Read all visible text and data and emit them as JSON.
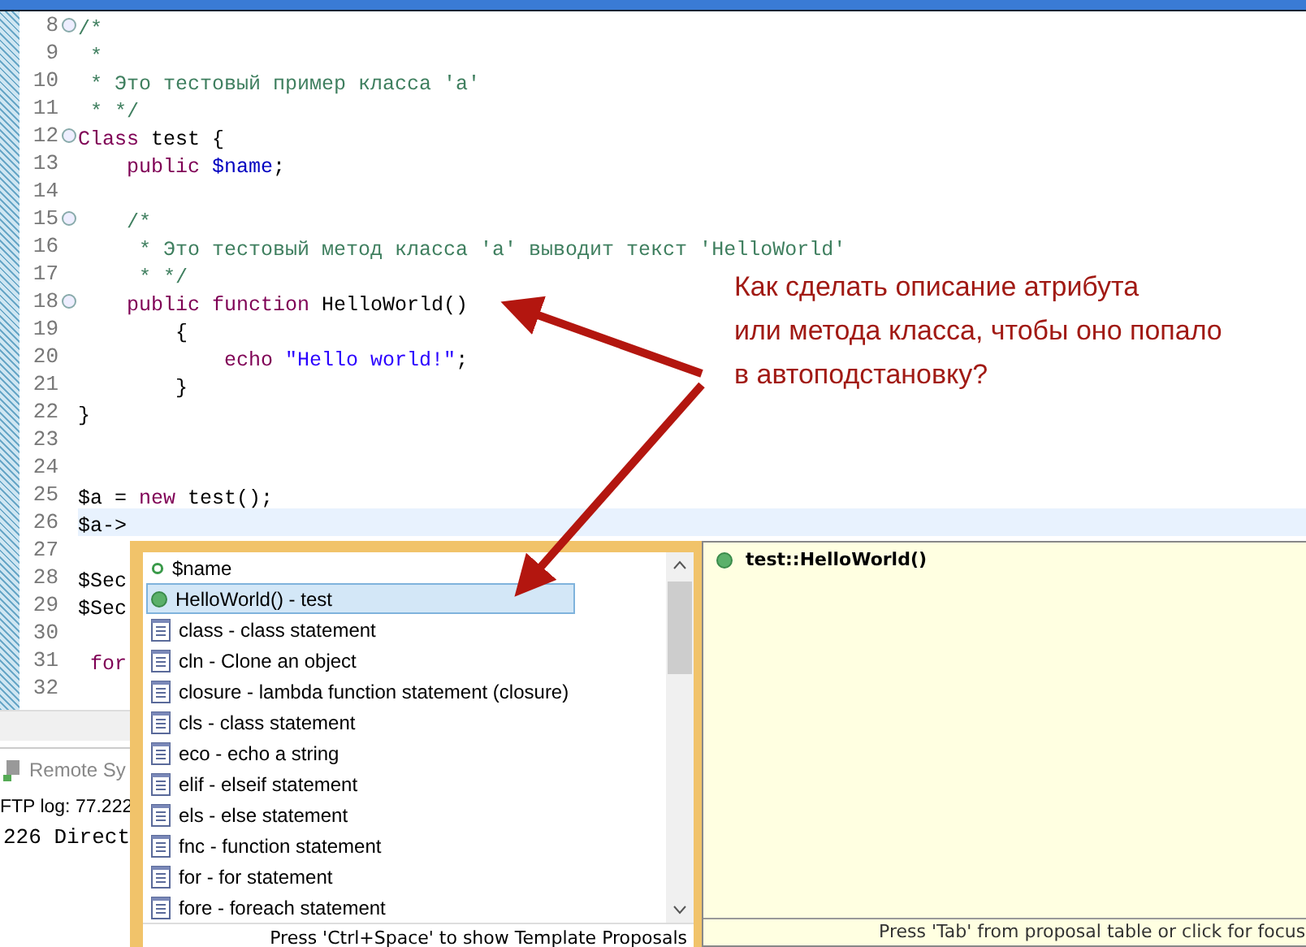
{
  "editor": {
    "lines": [
      {
        "number": "8",
        "foldable": true,
        "current": false,
        "tokens": [
          {
            "kind": "comment",
            "text": "/*"
          }
        ]
      },
      {
        "number": "9",
        "foldable": false,
        "current": false,
        "tokens": [
          {
            "kind": "comment",
            "text": " *"
          }
        ]
      },
      {
        "number": "10",
        "foldable": false,
        "current": false,
        "tokens": [
          {
            "kind": "comment",
            "text": " * Это тестовый пример класса 'a'"
          }
        ]
      },
      {
        "number": "11",
        "foldable": false,
        "current": false,
        "tokens": [
          {
            "kind": "comment",
            "text": " * */"
          }
        ]
      },
      {
        "number": "12",
        "foldable": true,
        "current": false,
        "tokens": [
          {
            "kind": "keyword",
            "text": "Class"
          },
          {
            "kind": "plain",
            "text": " test {"
          }
        ]
      },
      {
        "number": "13",
        "foldable": false,
        "current": false,
        "tokens": [
          {
            "kind": "keyword",
            "text": "    public"
          },
          {
            "kind": "variable",
            "text": " $name"
          },
          {
            "kind": "plain",
            "text": ";"
          }
        ]
      },
      {
        "number": "14",
        "foldable": false,
        "current": false
      },
      {
        "number": "15",
        "foldable": true,
        "current": false,
        "tokens": [
          {
            "kind": "comment",
            "text": "    /*"
          }
        ]
      },
      {
        "number": "16",
        "foldable": false,
        "current": false,
        "tokens": [
          {
            "kind": "comment",
            "text": "     * Это тестовый метод класса 'a' выводит текст 'HelloWorld'"
          }
        ]
      },
      {
        "number": "17",
        "foldable": false,
        "current": false,
        "tokens": [
          {
            "kind": "comment",
            "text": "     * */"
          }
        ]
      },
      {
        "number": "18",
        "foldable": true,
        "current": false,
        "tokens": [
          {
            "kind": "keyword",
            "text": "    public function"
          },
          {
            "kind": "plain",
            "text": " HelloWorld()"
          }
        ]
      },
      {
        "number": "19",
        "foldable": false,
        "current": false,
        "tokens": [
          {
            "kind": "plain",
            "text": "        {"
          }
        ]
      },
      {
        "number": "20",
        "foldable": false,
        "current": false,
        "tokens": [
          {
            "kind": "keyword",
            "text": "            echo"
          },
          {
            "kind": "string",
            "text": " \"Hello world!\""
          },
          {
            "kind": "plain",
            "text": ";"
          }
        ]
      },
      {
        "number": "21",
        "foldable": false,
        "current": false,
        "tokens": [
          {
            "kind": "plain",
            "text": "        }"
          }
        ]
      },
      {
        "number": "22",
        "foldable": false,
        "current": false,
        "tokens": [
          {
            "kind": "plain",
            "text": "}"
          }
        ]
      },
      {
        "number": "23",
        "foldable": false,
        "current": false
      },
      {
        "number": "24",
        "foldable": false,
        "current": false
      },
      {
        "number": "25",
        "foldable": false,
        "current": false,
        "tokens": [
          {
            "kind": "plain",
            "text": "$a = "
          },
          {
            "kind": "keyword",
            "text": "new"
          },
          {
            "kind": "plain",
            "text": " test();"
          }
        ]
      },
      {
        "number": "26",
        "foldable": false,
        "current": true,
        "tokens": [
          {
            "kind": "plain",
            "text": "$a->"
          }
        ]
      },
      {
        "number": "27",
        "foldable": false,
        "current": false
      },
      {
        "number": "28",
        "foldable": false,
        "current": false,
        "tokens": [
          {
            "kind": "plain",
            "text": "$Sec"
          }
        ]
      },
      {
        "number": "29",
        "foldable": false,
        "current": false,
        "tokens": [
          {
            "kind": "plain",
            "text": "$Sec"
          }
        ]
      },
      {
        "number": "30",
        "foldable": false,
        "current": false
      },
      {
        "number": "31",
        "foldable": false,
        "current": false,
        "tokens": [
          {
            "kind": "keyword",
            "text": " for"
          }
        ]
      },
      {
        "number": "32",
        "foldable": false,
        "current": false
      }
    ]
  },
  "bottom_panel": {
    "tab": "Remote Sy",
    "log_label": "FTP log: 77.222",
    "log_line": "226 Direct"
  },
  "annotation": {
    "lines": [
      "Как сделать описание атрибута",
      "или метода класса, чтобы оно попало",
      "в автоподстановку?"
    ]
  },
  "completion": {
    "proposals": [
      {
        "kind": "field",
        "label": "$name",
        "selected": false
      },
      {
        "kind": "method",
        "label": "HelloWorld() - test",
        "selected": true
      },
      {
        "kind": "template",
        "label": "class - class statement",
        "selected": false
      },
      {
        "kind": "template",
        "label": "cln - Clone an object",
        "selected": false
      },
      {
        "kind": "template",
        "label": "closure - lambda function statement (closure)",
        "selected": false
      },
      {
        "kind": "template",
        "label": "cls - class statement",
        "selected": false
      },
      {
        "kind": "template",
        "label": "eco - echo a string",
        "selected": false
      },
      {
        "kind": "template",
        "label": "elif - elseif statement",
        "selected": false
      },
      {
        "kind": "template",
        "label": "els - else statement",
        "selected": false
      },
      {
        "kind": "template",
        "label": "fnc - function statement",
        "selected": false
      },
      {
        "kind": "template",
        "label": "for - for statement",
        "selected": false
      },
      {
        "kind": "template",
        "label": "fore - foreach statement",
        "selected": false
      }
    ],
    "hint": "Press 'Ctrl+Space' to show Template Proposals",
    "info": {
      "title": "test::HelloWorld()",
      "hint": "Press 'Tab' from proposal table or click for focus"
    }
  }
}
